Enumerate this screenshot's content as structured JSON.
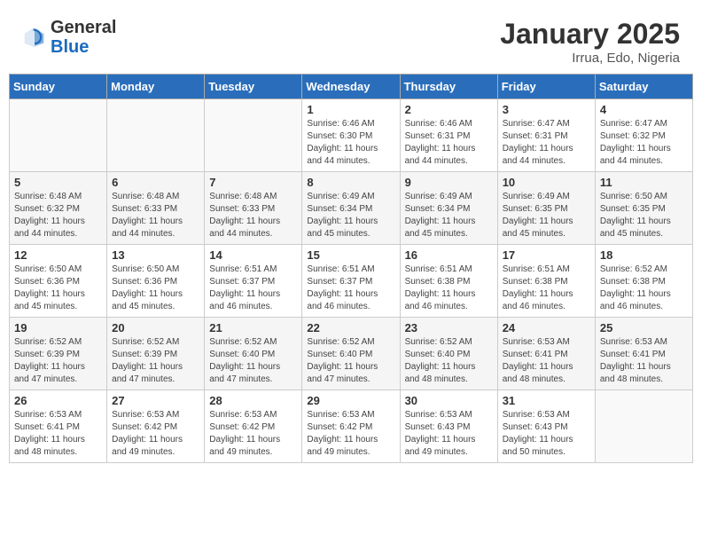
{
  "header": {
    "logo": {
      "general": "General",
      "blue": "Blue"
    },
    "title": "January 2025",
    "subtitle": "Irrua, Edo, Nigeria"
  },
  "weekdays": [
    "Sunday",
    "Monday",
    "Tuesday",
    "Wednesday",
    "Thursday",
    "Friday",
    "Saturday"
  ],
  "weeks": [
    [
      {
        "day": "",
        "info": ""
      },
      {
        "day": "",
        "info": ""
      },
      {
        "day": "",
        "info": ""
      },
      {
        "day": "1",
        "info": "Sunrise: 6:46 AM\nSunset: 6:30 PM\nDaylight: 11 hours and 44 minutes."
      },
      {
        "day": "2",
        "info": "Sunrise: 6:46 AM\nSunset: 6:31 PM\nDaylight: 11 hours and 44 minutes."
      },
      {
        "day": "3",
        "info": "Sunrise: 6:47 AM\nSunset: 6:31 PM\nDaylight: 11 hours and 44 minutes."
      },
      {
        "day": "4",
        "info": "Sunrise: 6:47 AM\nSunset: 6:32 PM\nDaylight: 11 hours and 44 minutes."
      }
    ],
    [
      {
        "day": "5",
        "info": "Sunrise: 6:48 AM\nSunset: 6:32 PM\nDaylight: 11 hours and 44 minutes."
      },
      {
        "day": "6",
        "info": "Sunrise: 6:48 AM\nSunset: 6:33 PM\nDaylight: 11 hours and 44 minutes."
      },
      {
        "day": "7",
        "info": "Sunrise: 6:48 AM\nSunset: 6:33 PM\nDaylight: 11 hours and 44 minutes."
      },
      {
        "day": "8",
        "info": "Sunrise: 6:49 AM\nSunset: 6:34 PM\nDaylight: 11 hours and 45 minutes."
      },
      {
        "day": "9",
        "info": "Sunrise: 6:49 AM\nSunset: 6:34 PM\nDaylight: 11 hours and 45 minutes."
      },
      {
        "day": "10",
        "info": "Sunrise: 6:49 AM\nSunset: 6:35 PM\nDaylight: 11 hours and 45 minutes."
      },
      {
        "day": "11",
        "info": "Sunrise: 6:50 AM\nSunset: 6:35 PM\nDaylight: 11 hours and 45 minutes."
      }
    ],
    [
      {
        "day": "12",
        "info": "Sunrise: 6:50 AM\nSunset: 6:36 PM\nDaylight: 11 hours and 45 minutes."
      },
      {
        "day": "13",
        "info": "Sunrise: 6:50 AM\nSunset: 6:36 PM\nDaylight: 11 hours and 45 minutes."
      },
      {
        "day": "14",
        "info": "Sunrise: 6:51 AM\nSunset: 6:37 PM\nDaylight: 11 hours and 46 minutes."
      },
      {
        "day": "15",
        "info": "Sunrise: 6:51 AM\nSunset: 6:37 PM\nDaylight: 11 hours and 46 minutes."
      },
      {
        "day": "16",
        "info": "Sunrise: 6:51 AM\nSunset: 6:38 PM\nDaylight: 11 hours and 46 minutes."
      },
      {
        "day": "17",
        "info": "Sunrise: 6:51 AM\nSunset: 6:38 PM\nDaylight: 11 hours and 46 minutes."
      },
      {
        "day": "18",
        "info": "Sunrise: 6:52 AM\nSunset: 6:38 PM\nDaylight: 11 hours and 46 minutes."
      }
    ],
    [
      {
        "day": "19",
        "info": "Sunrise: 6:52 AM\nSunset: 6:39 PM\nDaylight: 11 hours and 47 minutes."
      },
      {
        "day": "20",
        "info": "Sunrise: 6:52 AM\nSunset: 6:39 PM\nDaylight: 11 hours and 47 minutes."
      },
      {
        "day": "21",
        "info": "Sunrise: 6:52 AM\nSunset: 6:40 PM\nDaylight: 11 hours and 47 minutes."
      },
      {
        "day": "22",
        "info": "Sunrise: 6:52 AM\nSunset: 6:40 PM\nDaylight: 11 hours and 47 minutes."
      },
      {
        "day": "23",
        "info": "Sunrise: 6:52 AM\nSunset: 6:40 PM\nDaylight: 11 hours and 48 minutes."
      },
      {
        "day": "24",
        "info": "Sunrise: 6:53 AM\nSunset: 6:41 PM\nDaylight: 11 hours and 48 minutes."
      },
      {
        "day": "25",
        "info": "Sunrise: 6:53 AM\nSunset: 6:41 PM\nDaylight: 11 hours and 48 minutes."
      }
    ],
    [
      {
        "day": "26",
        "info": "Sunrise: 6:53 AM\nSunset: 6:41 PM\nDaylight: 11 hours and 48 minutes."
      },
      {
        "day": "27",
        "info": "Sunrise: 6:53 AM\nSunset: 6:42 PM\nDaylight: 11 hours and 49 minutes."
      },
      {
        "day": "28",
        "info": "Sunrise: 6:53 AM\nSunset: 6:42 PM\nDaylight: 11 hours and 49 minutes."
      },
      {
        "day": "29",
        "info": "Sunrise: 6:53 AM\nSunset: 6:42 PM\nDaylight: 11 hours and 49 minutes."
      },
      {
        "day": "30",
        "info": "Sunrise: 6:53 AM\nSunset: 6:43 PM\nDaylight: 11 hours and 49 minutes."
      },
      {
        "day": "31",
        "info": "Sunrise: 6:53 AM\nSunset: 6:43 PM\nDaylight: 11 hours and 50 minutes."
      },
      {
        "day": "",
        "info": ""
      }
    ]
  ]
}
